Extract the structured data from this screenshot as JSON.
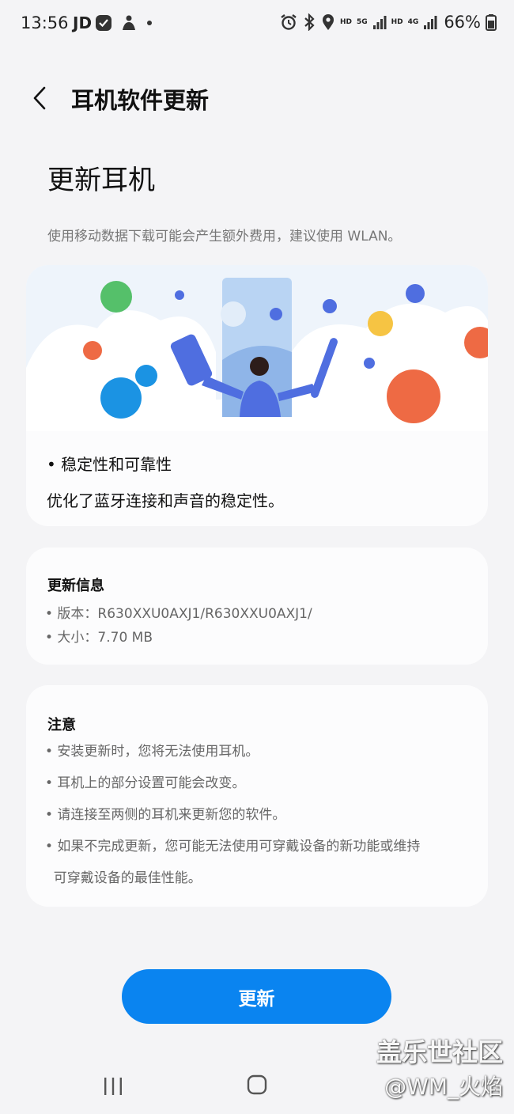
{
  "status_bar": {
    "time": "13:56",
    "carrier": "JD",
    "network_5g": "5G",
    "network_4g": "4G",
    "hd_label": "HD",
    "battery_percent": "66%",
    "icons": [
      "check-badge-icon",
      "person-icon",
      "dot-icon",
      "alarm-icon",
      "bluetooth-icon",
      "location-icon",
      "signal-icon",
      "battery-icon"
    ]
  },
  "header": {
    "title": "耳机软件更新"
  },
  "main": {
    "section_title": "更新耳机",
    "data_notice": "使用移动数据下载可能会产生额外费用，建议使用 WLAN。",
    "release_notes": {
      "bullet": "• 稳定性和可靠性",
      "description": "优化了蓝牙连接和声音的稳定性。"
    },
    "update_info": {
      "title": "更新信息",
      "version": "• 版本：R630XXU0AXJ1/R630XXU0AXJ1/",
      "size": "• 大小：7.70 MB"
    },
    "notes": {
      "title": "注意",
      "items": [
        "• 安装更新时，您将无法使用耳机。",
        "• 耳机上的部分设置可能会改变。",
        "• 请连接至两侧的耳机来更新您的软件。",
        "• 如果不完成更新，您可能无法使用可穿戴设备的新功能或维持",
        "  可穿戴设备的最佳性能。"
      ]
    },
    "update_button": "更新"
  },
  "watermark": {
    "title": "盖乐世社区",
    "author": "@WM_火焰"
  },
  "colors": {
    "accent": "#0a84f0",
    "background": "#f4f4f6",
    "card": "#fcfcfd"
  }
}
